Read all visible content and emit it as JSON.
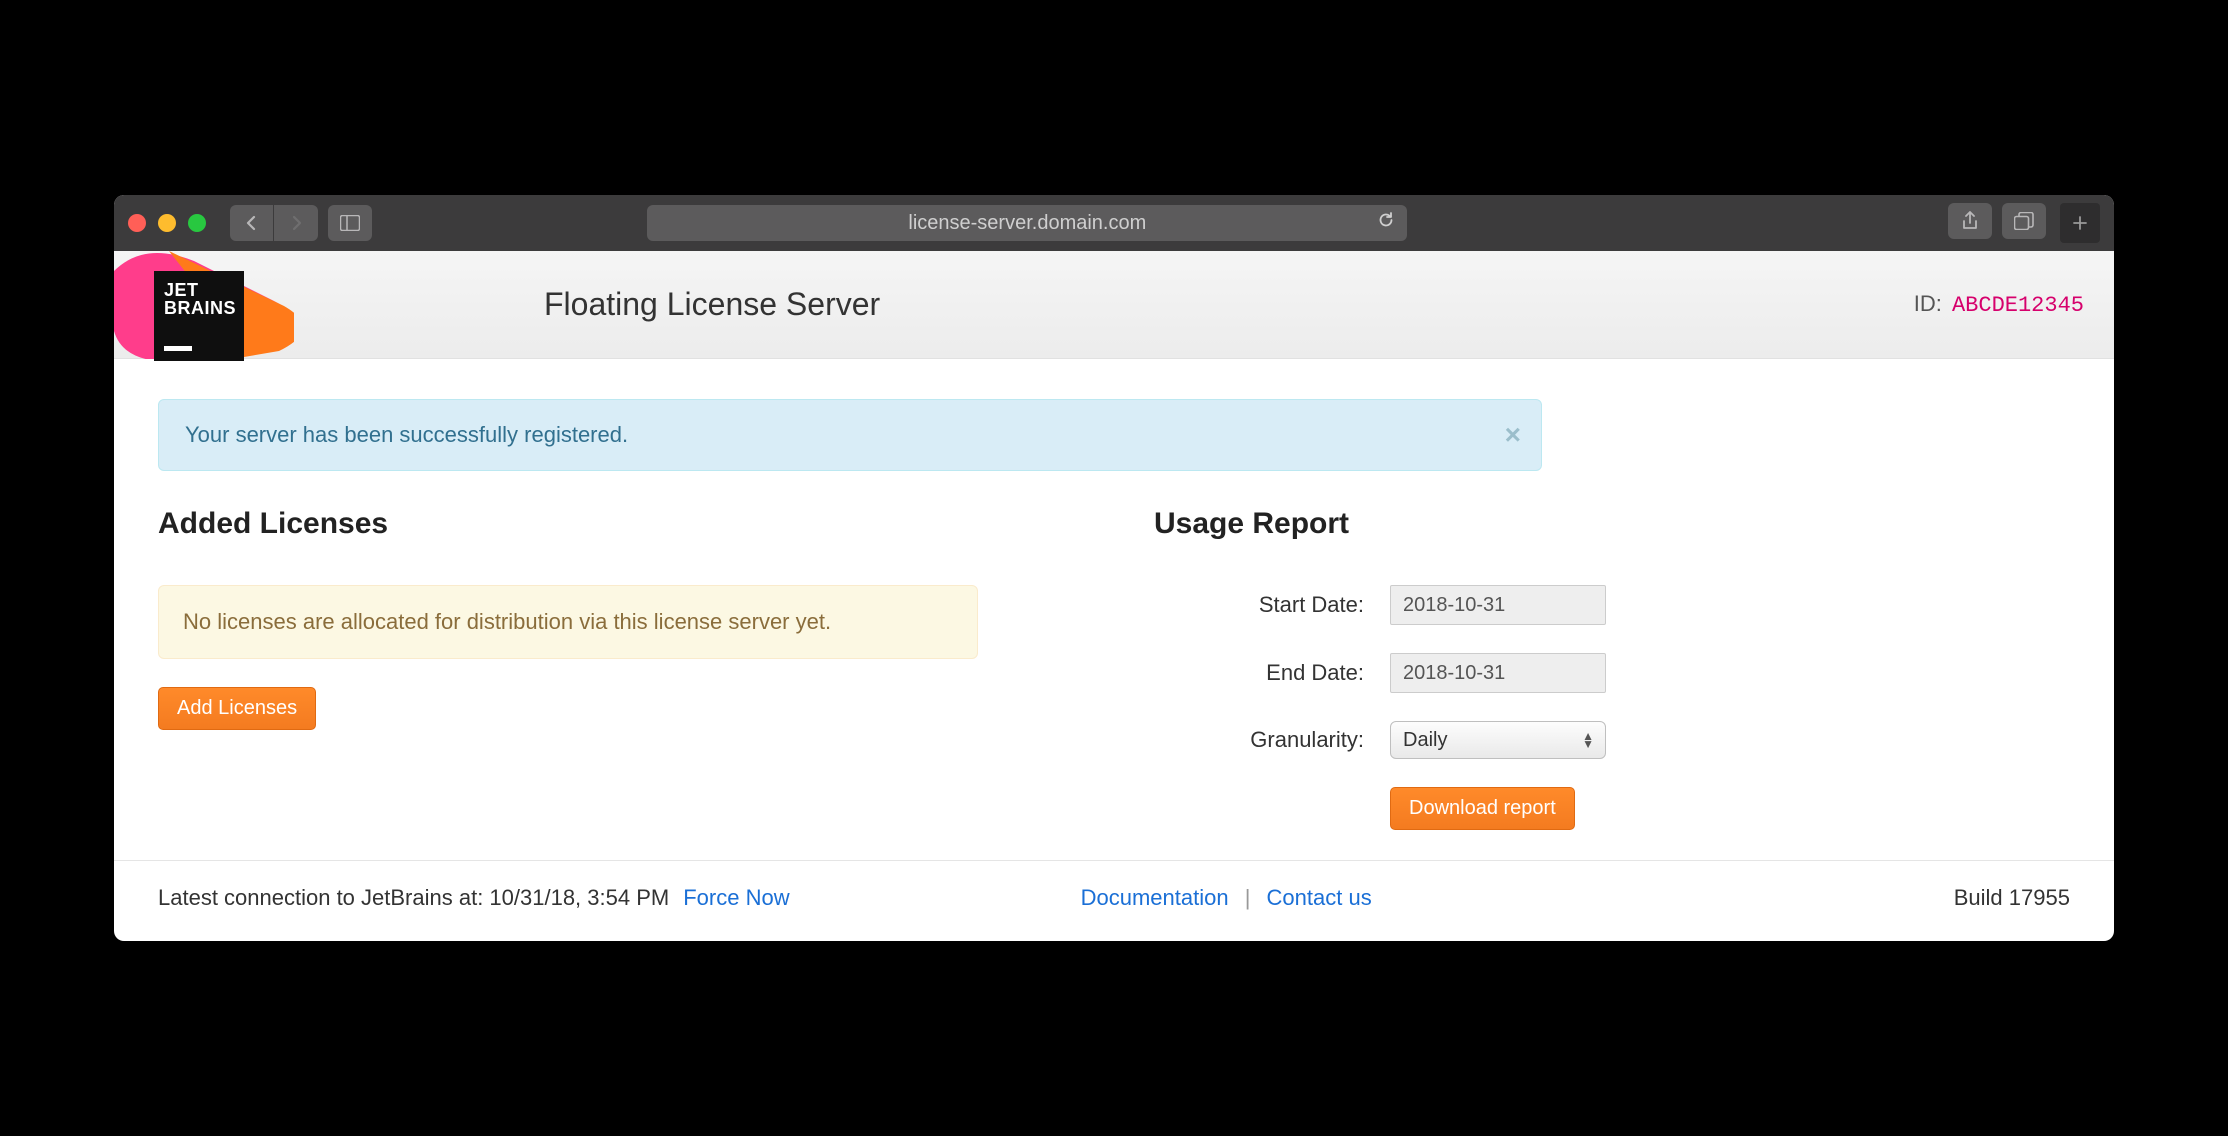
{
  "browser": {
    "url": "license-server.domain.com"
  },
  "header": {
    "logo_line1": "JET",
    "logo_line2": "BRAINS",
    "title": "Floating License Server",
    "id_label": "ID:",
    "id_value": "ABCDE12345"
  },
  "alert": {
    "message": "Your server has been successfully registered."
  },
  "licenses": {
    "title": "Added Licenses",
    "empty_message": "No licenses are allocated for distribution via this license server yet.",
    "add_button": "Add Licenses"
  },
  "usage_report": {
    "title": "Usage Report",
    "start_date_label": "Start Date:",
    "start_date_value": "2018-10-31",
    "end_date_label": "End Date:",
    "end_date_value": "2018-10-31",
    "granularity_label": "Granularity:",
    "granularity_value": "Daily",
    "download_button": "Download report"
  },
  "footer": {
    "latest_connection_prefix": "Latest connection to JetBrains at: ",
    "latest_connection_time": "10/31/18, 3:54 PM",
    "force_now": "Force Now",
    "documentation": "Documentation",
    "contact_us": "Contact us",
    "build": "Build 17955"
  }
}
